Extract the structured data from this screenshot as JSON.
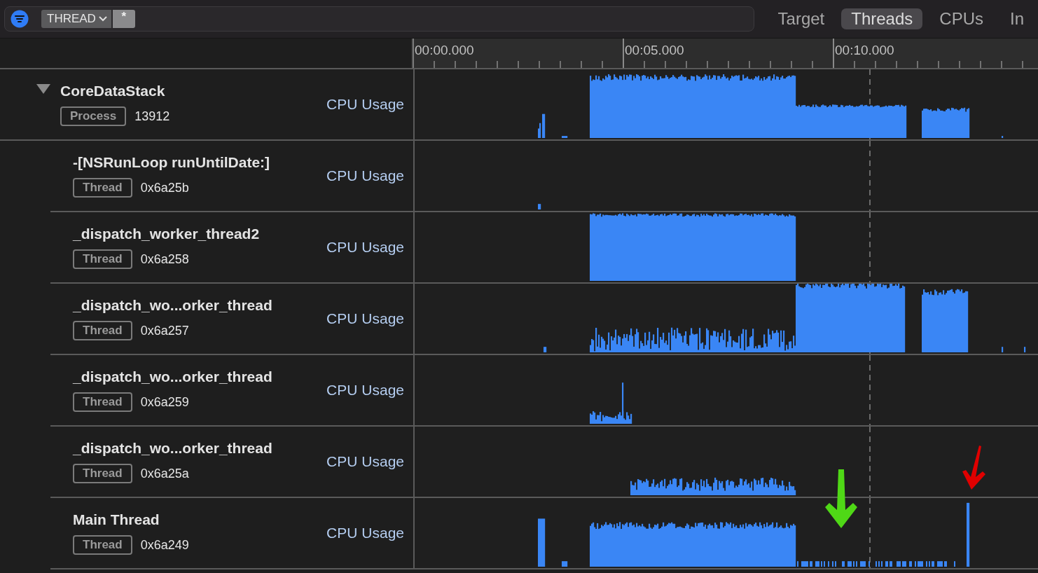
{
  "filter": {
    "token": "THREAD",
    "value": "*"
  },
  "tabs": [
    {
      "label": "Target",
      "selected": false
    },
    {
      "label": "Threads",
      "selected": true
    },
    {
      "label": "CPUs",
      "selected": false
    },
    {
      "label": "In",
      "selected": false
    }
  ],
  "ruler": {
    "ticks": [
      "00:00.000",
      "00:05.000",
      "00:10.000"
    ]
  },
  "process": {
    "name": "CoreDataStack",
    "expanded": true,
    "tag": "Process",
    "id": "13912",
    "metric": "CPU Usage",
    "children": [
      {
        "name": "-[NSRunLoop runUntilDate:]",
        "tag": "Thread",
        "id": "0x6a25b",
        "metric": "CPU Usage"
      },
      {
        "name": "_dispatch_worker_thread2",
        "tag": "Thread",
        "id": "0x6a258",
        "metric": "CPU Usage"
      },
      {
        "name": "_dispatch_wo...orker_thread",
        "tag": "Thread",
        "id": "0x6a257",
        "metric": "CPU Usage"
      },
      {
        "name": "_dispatch_wo...orker_thread",
        "tag": "Thread",
        "id": "0x6a259",
        "metric": "CPU Usage"
      },
      {
        "name": "_dispatch_wo...orker_thread",
        "tag": "Thread",
        "id": "0x6a25a",
        "metric": "CPU Usage"
      },
      {
        "name": "Main Thread",
        "tag": "Thread",
        "id": "0x6a249",
        "metric": "CPU Usage"
      }
    ]
  }
}
